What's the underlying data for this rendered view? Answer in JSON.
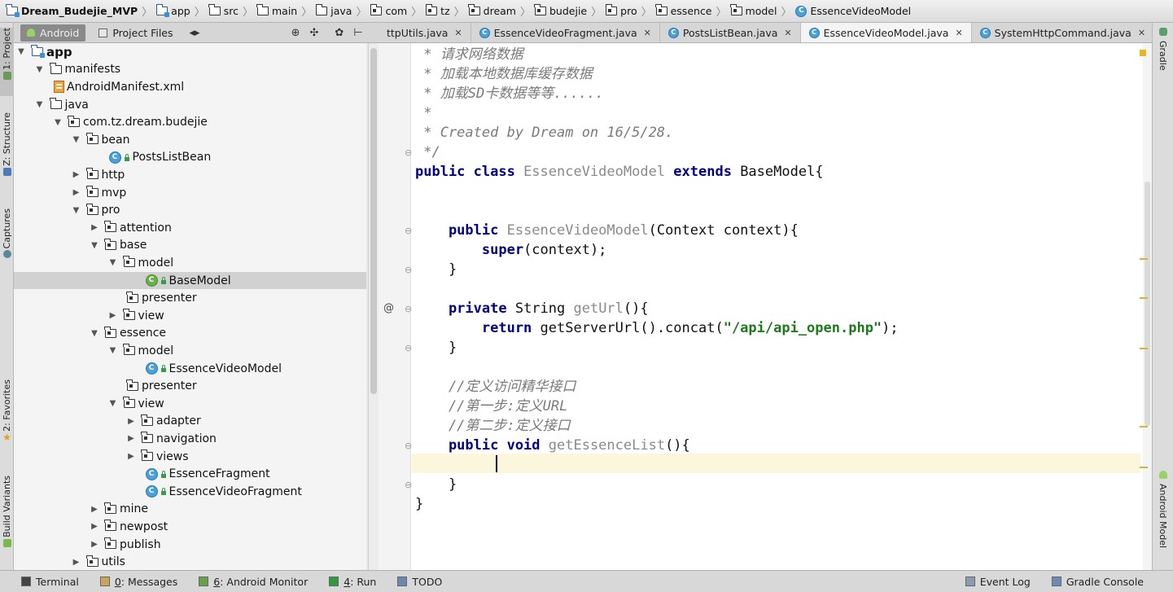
{
  "breadcrumb": [
    {
      "label": "Dream_Budejie_MVP",
      "icon": "module-icon"
    },
    {
      "label": "app",
      "icon": "module-icon"
    },
    {
      "label": "src",
      "icon": "folder-icon"
    },
    {
      "label": "main",
      "icon": "folder-icon"
    },
    {
      "label": "java",
      "icon": "folder-icon"
    },
    {
      "label": "com",
      "icon": "package-icon"
    },
    {
      "label": "tz",
      "icon": "package-icon"
    },
    {
      "label": "dream",
      "icon": "package-icon"
    },
    {
      "label": "budejie",
      "icon": "package-icon"
    },
    {
      "label": "pro",
      "icon": "package-icon"
    },
    {
      "label": "essence",
      "icon": "package-icon"
    },
    {
      "label": "model",
      "icon": "package-icon"
    },
    {
      "label": "EssenceVideoModel",
      "icon": "class-icon"
    }
  ],
  "left_tools": {
    "project": "1: Project",
    "structure": "Z: Structure",
    "captures": "Captures",
    "favorites": "2: Favorites",
    "build_variants": "Build Variants"
  },
  "right_tools": {
    "gradle": "Gradle",
    "android_model": "Android Model"
  },
  "project_panel": {
    "view_android": "Android",
    "view_project_files": "Project Files"
  },
  "tree": [
    {
      "label": "app",
      "depth": 0,
      "expanded": true,
      "icon": "module",
      "bold": true
    },
    {
      "label": "manifests",
      "depth": 1,
      "expanded": true,
      "icon": "folder"
    },
    {
      "label": "AndroidManifest.xml",
      "depth": 2,
      "icon": "xml"
    },
    {
      "label": "java",
      "depth": 1,
      "expanded": true,
      "icon": "folder"
    },
    {
      "label": "com.tz.dream.budejie",
      "depth": 2,
      "expanded": true,
      "icon": "package"
    },
    {
      "label": "bean",
      "depth": 3,
      "expanded": true,
      "icon": "package"
    },
    {
      "label": "PostsListBean",
      "depth": 5,
      "icon": "class"
    },
    {
      "label": "http",
      "depth": 3,
      "expanded": false,
      "icon": "package"
    },
    {
      "label": "mvp",
      "depth": 3,
      "expanded": false,
      "icon": "package"
    },
    {
      "label": "pro",
      "depth": 3,
      "expanded": true,
      "icon": "package"
    },
    {
      "label": "attention",
      "depth": 4,
      "expanded": false,
      "icon": "package"
    },
    {
      "label": "base",
      "depth": 4,
      "expanded": true,
      "icon": "package"
    },
    {
      "label": "model",
      "depth": 5,
      "expanded": true,
      "icon": "package"
    },
    {
      "label": "BaseModel",
      "depth": 7,
      "icon": "abstract-class",
      "selected": true
    },
    {
      "label": "presenter",
      "depth": 6,
      "icon": "package"
    },
    {
      "label": "view",
      "depth": 5,
      "expanded": false,
      "icon": "package"
    },
    {
      "label": "essence",
      "depth": 4,
      "expanded": true,
      "icon": "package"
    },
    {
      "label": "model",
      "depth": 5,
      "expanded": true,
      "icon": "package"
    },
    {
      "label": "EssenceVideoModel",
      "depth": 7,
      "icon": "class"
    },
    {
      "label": "presenter",
      "depth": 6,
      "icon": "package"
    },
    {
      "label": "view",
      "depth": 5,
      "expanded": true,
      "icon": "package"
    },
    {
      "label": "adapter",
      "depth": 6,
      "expanded": false,
      "icon": "package"
    },
    {
      "label": "navigation",
      "depth": 6,
      "expanded": false,
      "icon": "package"
    },
    {
      "label": "views",
      "depth": 6,
      "expanded": false,
      "icon": "package"
    },
    {
      "label": "EssenceFragment",
      "depth": 7,
      "icon": "class"
    },
    {
      "label": "EssenceVideoFragment",
      "depth": 7,
      "icon": "class"
    },
    {
      "label": "mine",
      "depth": 4,
      "expanded": false,
      "icon": "package"
    },
    {
      "label": "newpost",
      "depth": 4,
      "expanded": false,
      "icon": "package"
    },
    {
      "label": "publish",
      "depth": 4,
      "expanded": false,
      "icon": "package"
    },
    {
      "label": "utils",
      "depth": 3,
      "expanded": false,
      "icon": "package"
    }
  ],
  "editor_tabs": [
    {
      "label": "ttpUtils.java",
      "active": false,
      "icon": false
    },
    {
      "label": "EssenceVideoFragment.java",
      "active": false,
      "icon": true
    },
    {
      "label": "PostsListBean.java",
      "active": false,
      "icon": true
    },
    {
      "label": "EssenceVideoModel.java",
      "active": true,
      "icon": true
    },
    {
      "label": "SystemHttpCommand.java",
      "active": false,
      "icon": true
    }
  ],
  "tab_overflow": "4",
  "code_lines": [
    [
      {
        "t": " * 请求网络数据",
        "c": "cm"
      }
    ],
    [
      {
        "t": " * 加载本地数据库缓存数据",
        "c": "cm"
      }
    ],
    [
      {
        "t": " * 加载SD卡数据等等......",
        "c": "cm"
      }
    ],
    [
      {
        "t": " *",
        "c": "cm"
      }
    ],
    [
      {
        "t": " * Created by Dream on 16/5/28.",
        "c": "cm"
      }
    ],
    [
      {
        "t": " */",
        "c": "cm"
      }
    ],
    [
      {
        "t": "public class ",
        "c": "kw"
      },
      {
        "t": "EssenceVideoModel ",
        "c": "fn"
      },
      {
        "t": "extends ",
        "c": "kw"
      },
      {
        "t": "BaseModel{",
        "c": ""
      }
    ],
    [],
    [],
    [
      {
        "t": "    public ",
        "c": "kw"
      },
      {
        "t": "EssenceVideoModel",
        "c": "fn"
      },
      {
        "t": "(Context context){",
        "c": ""
      }
    ],
    [
      {
        "t": "        super",
        "c": "kw"
      },
      {
        "t": "(context);",
        "c": ""
      }
    ],
    [
      {
        "t": "    }",
        "c": ""
      }
    ],
    [],
    [
      {
        "t": "    private ",
        "c": "kw"
      },
      {
        "t": "String ",
        "c": ""
      },
      {
        "t": "getUrl",
        "c": "fn"
      },
      {
        "t": "(){",
        "c": ""
      }
    ],
    [
      {
        "t": "        return ",
        "c": "kw"
      },
      {
        "t": "getServerUrl().concat(",
        "c": ""
      },
      {
        "t": "\"/api/api_open.php\"",
        "c": "str"
      },
      {
        "t": ");",
        "c": ""
      }
    ],
    [
      {
        "t": "    }",
        "c": ""
      }
    ],
    [],
    [
      {
        "t": "    //定义访问精华接口",
        "c": "cm"
      }
    ],
    [
      {
        "t": "    //第一步:定义URL",
        "c": "cm"
      }
    ],
    [
      {
        "t": "    //第二步:定义接口",
        "c": "cm"
      }
    ],
    [
      {
        "t": "    public void ",
        "c": "kw"
      },
      {
        "t": "getEssenceList",
        "c": "fn"
      },
      {
        "t": "(){",
        "c": ""
      }
    ],
    [],
    [
      {
        "t": "    }",
        "c": ""
      }
    ],
    [
      {
        "t": "}",
        "c": ""
      }
    ]
  ],
  "bottom_tools": [
    {
      "key": "",
      "label": "Terminal",
      "name": "terminal-tool-button"
    },
    {
      "key": "0",
      "label": ": Messages",
      "name": "messages-tool-button"
    },
    {
      "key": "6",
      "label": ": Android Monitor",
      "name": "android-monitor-tool-button"
    },
    {
      "key": "4",
      "label": ": Run",
      "name": "run-tool-button"
    },
    {
      "key": "",
      "label": "TODO",
      "name": "todo-tool-button"
    }
  ],
  "bottom_right": {
    "event_log": "Event Log",
    "gradle_console": "Gradle Console"
  },
  "colors": {
    "keyword": "#000080",
    "comment": "#7a7a7a",
    "string": "#1c7a1c",
    "method_gray": "#8a8a8a",
    "current_line": "#fbf6dc",
    "selection": "#d1d1d1"
  }
}
